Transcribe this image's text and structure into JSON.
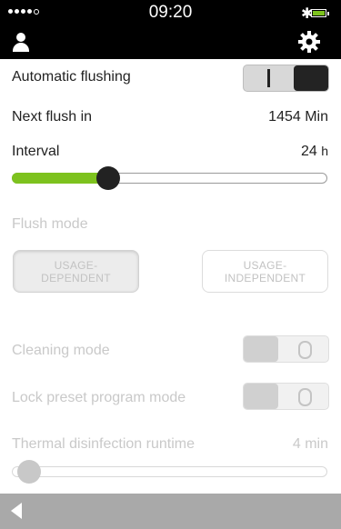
{
  "status_bar": {
    "time": "09:20"
  },
  "settings": {
    "automatic_flushing": {
      "label": "Automatic flushing",
      "toggle_symbol": "I",
      "state": "on"
    },
    "next_flush": {
      "label": "Next flush in",
      "value": "1454 Min"
    },
    "interval": {
      "label": "Interval",
      "value": "24",
      "unit": "h",
      "slider_fraction": 0.29
    },
    "flush_mode": {
      "label": "Flush mode",
      "options": [
        {
          "line1": "USAGE-",
          "line2": "DEPENDENT",
          "selected": true
        },
        {
          "line1": "USAGE-",
          "line2": "INDEPENDENT",
          "selected": false
        }
      ]
    },
    "cleaning_mode": {
      "label": "Cleaning mode",
      "toggle_symbol": "O",
      "state": "off"
    },
    "lock_preset": {
      "label": "Lock preset program mode",
      "toggle_symbol": "O",
      "state": "off"
    },
    "thermal_runtime": {
      "label": "Thermal disinfection runtime",
      "value": "4 min",
      "slider_fraction": 0.02
    }
  },
  "colors": {
    "accent_green": "#7dc21e",
    "header_bg": "#000000",
    "bottom_bar_bg": "#a9a9a9"
  },
  "icons": [
    "user-icon",
    "gear-icon",
    "bluetooth-icon",
    "battery-icon",
    "back-arrow-icon"
  ]
}
